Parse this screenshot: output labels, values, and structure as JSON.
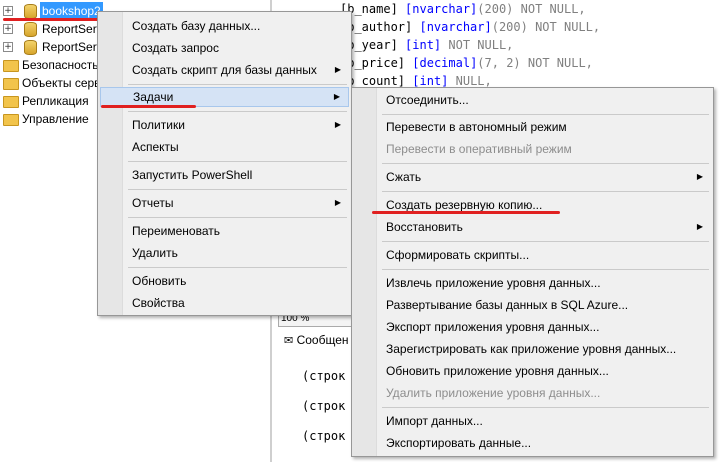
{
  "tree": {
    "items": [
      {
        "label": "bookshop2"
      },
      {
        "label": "ReportServ"
      },
      {
        "label": "ReportServ"
      },
      {
        "label": "Безопасность"
      },
      {
        "label": "Объекты серв"
      },
      {
        "label": "Репликация"
      },
      {
        "label": "Управление"
      }
    ]
  },
  "editor": {
    "code_lines": [
      {
        "name": "[b_name]",
        "type": "[nvarchar]",
        "args": "(200)",
        "rest": " NOT NULL,"
      },
      {
        "name": "[b_author]",
        "type": "[nvarchar]",
        "args": "(200)",
        "rest": " NOT NULL,"
      },
      {
        "name": "[b_year]",
        "type": "[int]",
        "args": "",
        "rest": " NOT NULL,"
      },
      {
        "name": "[b_price]",
        "type": "[decimal]",
        "args": "(7, 2)",
        "rest": " NOT NULL,"
      },
      {
        "name": "[b_count]",
        "type": "[int]",
        "args": "",
        "rest": " NULL,"
      }
    ],
    "zoom": "100 %",
    "messages_tab": "Сообщен",
    "messages": [
      "(строк",
      "(строк",
      "(строк"
    ]
  },
  "context_menu": {
    "items": [
      {
        "label": "Создать базу данных..."
      },
      {
        "label": "Создать запрос"
      },
      {
        "label": "Создать скрипт для базы данных"
      },
      {
        "label": "Задачи"
      },
      {
        "label": "Политики"
      },
      {
        "label": "Аспекты"
      },
      {
        "label": "Запустить PowerShell"
      },
      {
        "label": "Отчеты"
      },
      {
        "label": "Переименовать"
      },
      {
        "label": "Удалить"
      },
      {
        "label": "Обновить"
      },
      {
        "label": "Свойства"
      }
    ]
  },
  "tasks_submenu": {
    "items": [
      {
        "label": "Отсоединить..."
      },
      {
        "label": "Перевести в автономный режим"
      },
      {
        "label": "Перевести в оперативный режим"
      },
      {
        "label": "Сжать"
      },
      {
        "label": "Создать резервную копию..."
      },
      {
        "label": "Восстановить"
      },
      {
        "label": "Сформировать скрипты..."
      },
      {
        "label": "Извлечь приложение уровня данных..."
      },
      {
        "label": "Развертывание базы данных в SQL Azure..."
      },
      {
        "label": "Экспорт приложения уровня данных..."
      },
      {
        "label": "Зарегистрировать как приложение уровня данных..."
      },
      {
        "label": "Обновить приложение уровня данных..."
      },
      {
        "label": "Удалить приложение уровня данных..."
      },
      {
        "label": "Импорт данных..."
      },
      {
        "label": "Экспортировать данные..."
      }
    ]
  },
  "colors": {
    "selection": "#3399ff",
    "annotation_red": "#e02020",
    "keyword_blue": "#0000ff"
  }
}
